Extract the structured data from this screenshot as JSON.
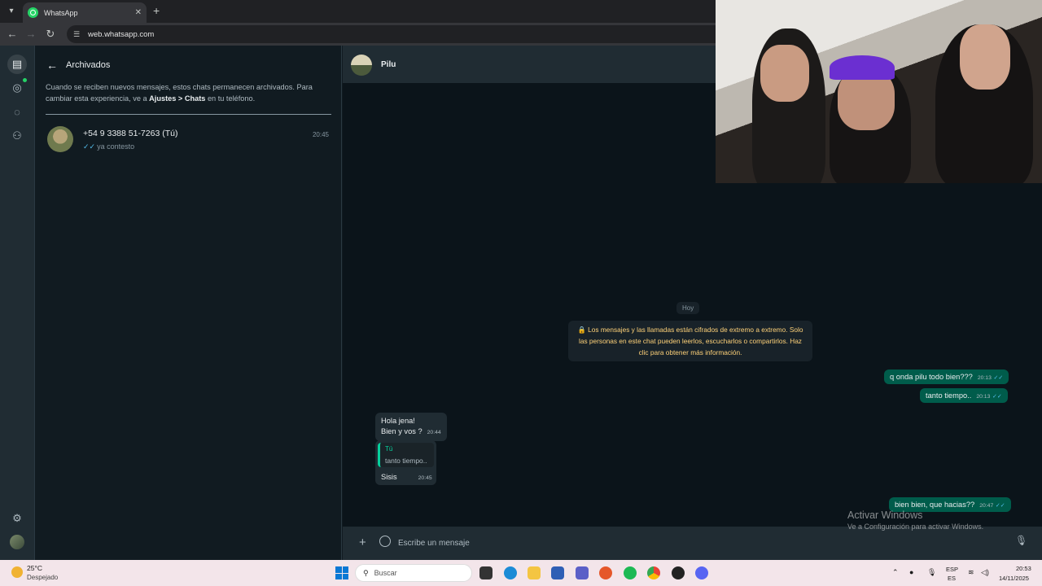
{
  "browser": {
    "tab_title": "WhatsApp",
    "url": "web.whatsapp.com"
  },
  "archive": {
    "title": "Archivados",
    "note_prefix": "Cuando se reciben nuevos mensajes, estos chats permanecen archivados. Para cambiar esta experiencia, ve a ",
    "note_bold_1": "Ajustes",
    "note_sep": " > ",
    "note_bold_2": "Chats",
    "note_suffix": " en tu teléfono."
  },
  "chat_item": {
    "name": "+54 9 3388 51-7263 (Tú)",
    "time": "20:45",
    "preview": "ya contesto"
  },
  "conversation": {
    "contact_name": "Pilu",
    "date_pill": "Hoy",
    "encryption_note": "🔒 Los mensajes y las llamadas están cifrados de extremo a extremo. Solo las personas en este chat pueden leerlos, escucharlos o compartirlos. Haz clic para obtener más información.",
    "messages": [
      {
        "dir": "out",
        "text": "q onda pilu todo bien???",
        "time": "20:13"
      },
      {
        "dir": "out",
        "text": "tanto tiempo..",
        "time": "20:13"
      },
      {
        "dir": "in",
        "line1": "Hola jena!",
        "line2": "Bien y vos ?",
        "time": "20:44"
      },
      {
        "dir": "in",
        "quote_author": "Tú",
        "quote_text": "tanto tiempo..",
        "text": "Sisis",
        "time": "20:45"
      },
      {
        "dir": "out",
        "text": "bien bien, que hacias??",
        "time": "20:47"
      }
    ],
    "composer_placeholder": "Escribe un mensaje"
  },
  "watermark": {
    "line1": "Activar Windows",
    "line2": "Ve a Configuración para activar Windows."
  },
  "taskbar": {
    "temp": "25°C",
    "weather": "Despejado",
    "search": "Buscar",
    "lang1": "ESP",
    "lang2": "ES",
    "time": "20:53",
    "date": "14/11/2025"
  },
  "colors": {
    "accent": "#25d366",
    "outgoing_bubble": "#005c4b",
    "incoming_bubble": "#202c33",
    "read_ticks": "#53bdeb"
  }
}
